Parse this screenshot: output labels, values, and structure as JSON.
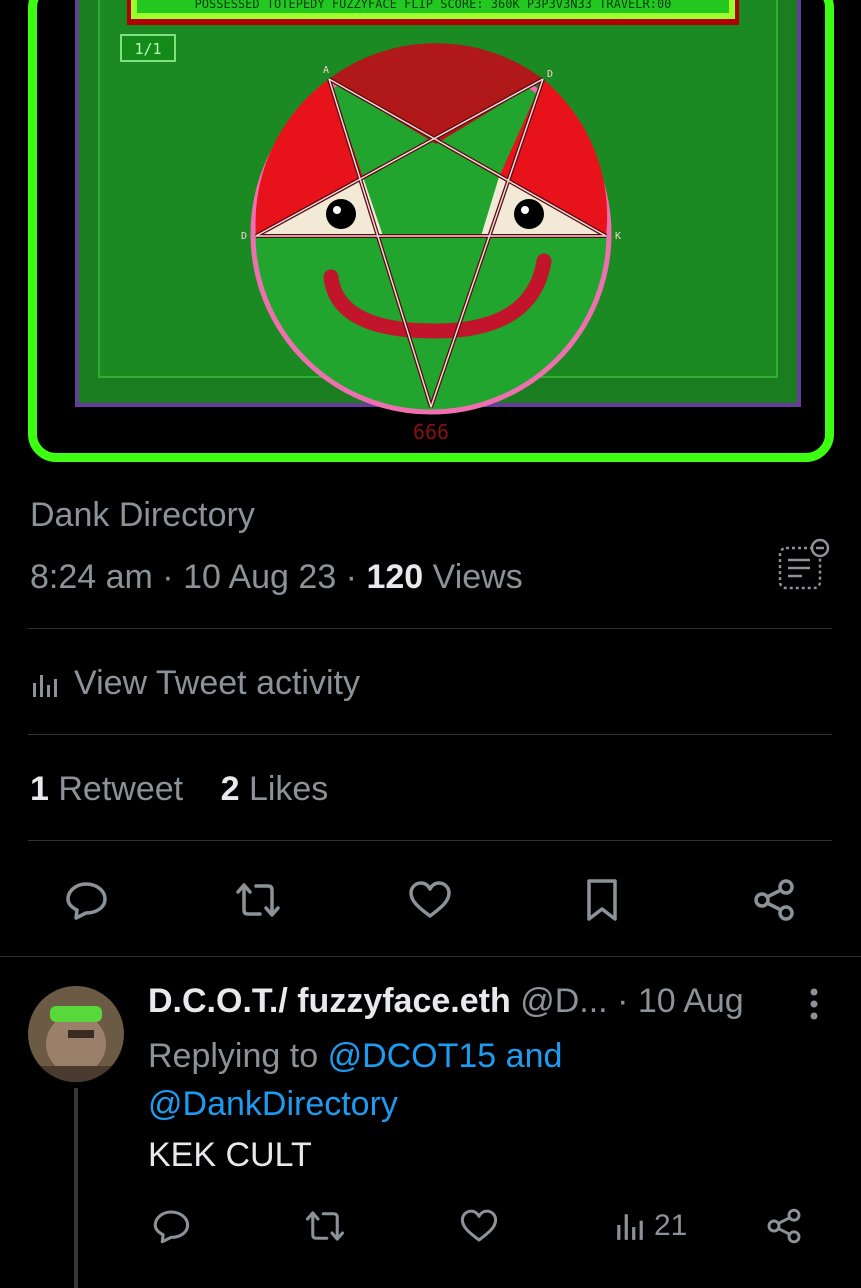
{
  "media": {
    "top_banner": "POSSESSED TOTEPEDY FUZZYFACE  FLIP SCORE: 360K  P3P3V3N33 TRAVELR:00",
    "page_indicator": "1/1",
    "vertex_labels": [
      "A",
      "D",
      "D",
      "K"
    ],
    "bottom_mark": "666",
    "colors": {
      "border": "#3cff12",
      "board": "#1c8a22",
      "face": "#22a52f",
      "red": "#e8121b",
      "darkred": "#b0181a"
    }
  },
  "tweet": {
    "author": "Dank Directory",
    "time": "8:24 am",
    "date": "10 Aug 23",
    "views_count": "120",
    "views_label": "Views",
    "sep": " · ",
    "activity_label": "View Tweet activity",
    "retweets_count": "1",
    "retweets_label": "Retweet",
    "likes_count": "2",
    "likes_label": "Likes"
  },
  "actions": [
    "reply-icon",
    "retweet-icon",
    "like-icon",
    "bookmark-icon",
    "share-icon"
  ],
  "reply": {
    "name": "D.C.O.T./ fuzzyface.eth",
    "handle": "@D...",
    "date": "· 10 Aug",
    "replying_prefix": "Replying to",
    "replying_to_1": "@DCOT15 and",
    "replying_to_2": "@DankDirectory",
    "text": "KEK CULT",
    "views": "21"
  }
}
